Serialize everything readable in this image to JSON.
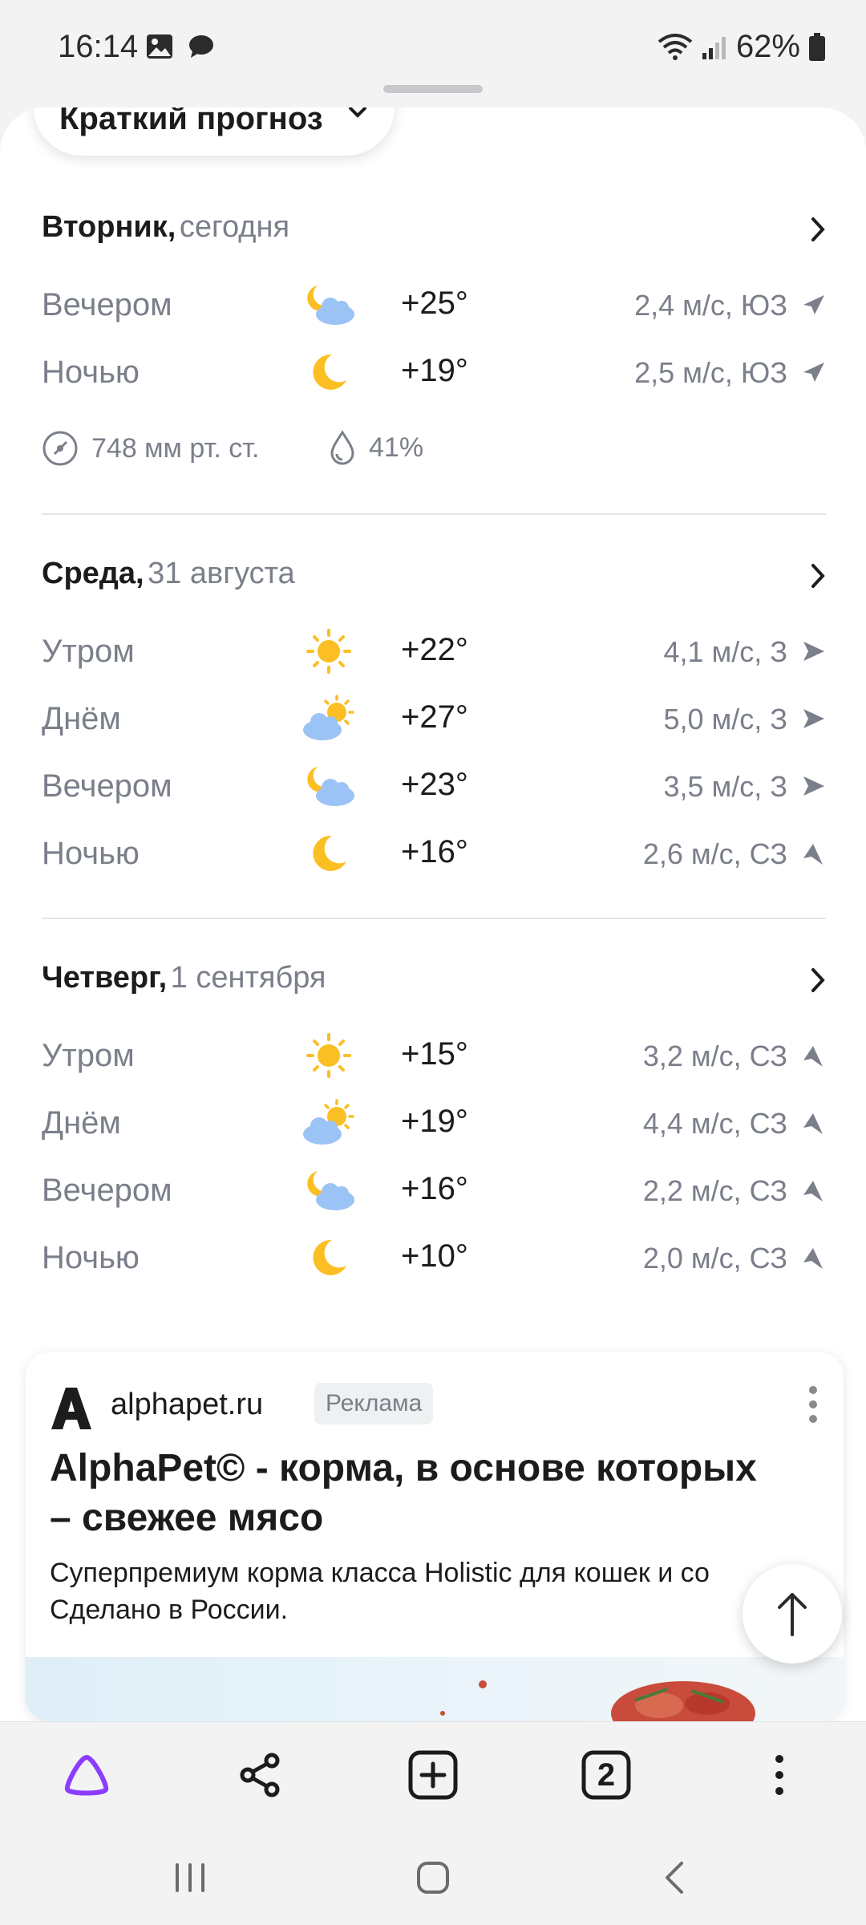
{
  "status": {
    "time": "16:14",
    "battery": "62%",
    "icons": [
      "gallery-icon",
      "message-icon",
      "wifi-icon",
      "signal-icon",
      "battery-icon"
    ]
  },
  "forecast_toggle": {
    "label": "Краткий прогноз"
  },
  "days": [
    {
      "name": "Вторник,",
      "date": "сегодня",
      "periods": [
        {
          "label": "Вечером",
          "icon": "night-cloudy-icon",
          "temp": "+25°",
          "wind": "2,4 м/с, ЮЗ",
          "wind_dir": "SW"
        },
        {
          "label": "Ночью",
          "icon": "moon-icon",
          "temp": "+19°",
          "wind": "2,5 м/с, ЮЗ",
          "wind_dir": "SW"
        }
      ],
      "pressure": "748 мм рт. ст.",
      "humidity": "41%"
    },
    {
      "name": "Среда,",
      "date": "31 августа",
      "periods": [
        {
          "label": "Утром",
          "icon": "sun-icon",
          "temp": "+22°",
          "wind": "4,1 м/с, З",
          "wind_dir": "W"
        },
        {
          "label": "Днём",
          "icon": "sun-cloud-icon",
          "temp": "+27°",
          "wind": "5,0 м/с, З",
          "wind_dir": "W"
        },
        {
          "label": "Вечером",
          "icon": "night-cloudy-icon",
          "temp": "+23°",
          "wind": "3,5 м/с, З",
          "wind_dir": "W"
        },
        {
          "label": "Ночью",
          "icon": "moon-icon",
          "temp": "+16°",
          "wind": "2,6 м/с, СЗ",
          "wind_dir": "NW"
        }
      ]
    },
    {
      "name": "Четверг,",
      "date": "1 сентября",
      "periods": [
        {
          "label": "Утром",
          "icon": "sun-icon",
          "temp": "+15°",
          "wind": "3,2 м/с, СЗ",
          "wind_dir": "NW"
        },
        {
          "label": "Днём",
          "icon": "sun-cloud-icon",
          "temp": "+19°",
          "wind": "4,4 м/с, СЗ",
          "wind_dir": "NW"
        },
        {
          "label": "Вечером",
          "icon": "night-cloudy-icon",
          "temp": "+16°",
          "wind": "2,2 м/с, СЗ",
          "wind_dir": "NW"
        },
        {
          "label": "Ночью",
          "icon": "moon-icon",
          "temp": "+10°",
          "wind": "2,0 м/с, СЗ",
          "wind_dir": "NW"
        }
      ]
    }
  ],
  "ad": {
    "domain": "alphapet.ru",
    "badge": "Реклама",
    "title": "AlphaPet© - корма, в основе которых – свежее мясо",
    "description_line1": "Суперпремиум корма класса Holistic для кошек и со",
    "description_line2": "Сделано в России."
  },
  "toolbar": {
    "items": [
      "alice-icon",
      "share-icon",
      "new-tab-icon",
      "tabs-icon",
      "more-icon"
    ],
    "tabs_count": "2"
  },
  "nav": {
    "items": [
      "recents-icon",
      "home-icon",
      "back-icon"
    ]
  },
  "colors": {
    "accent": "#8b3dff",
    "muted": "#7a7f8a",
    "sun": "#fbbf24",
    "cloud": "#9cc3f5"
  }
}
